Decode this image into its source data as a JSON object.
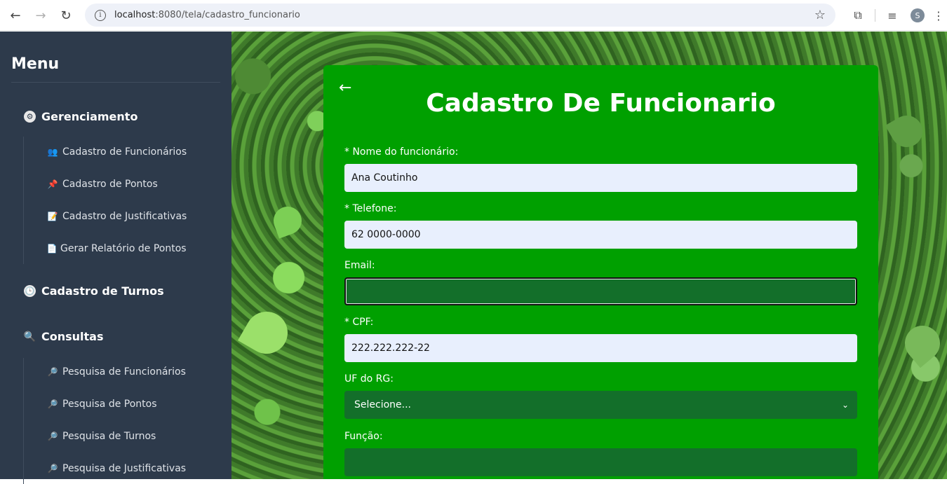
{
  "browser": {
    "url_host": "localhost",
    "url_path": ":8080/tela/cadastro_funcionario",
    "profile_initial": "S"
  },
  "sidebar": {
    "title": "Menu",
    "sections": [
      {
        "label": "Gerenciamento",
        "icon": "gear-icon",
        "items": [
          {
            "label": "Cadastro de Funcionários",
            "icon": "users-icon"
          },
          {
            "label": "Cadastro de Pontos",
            "icon": "pushpin-icon"
          },
          {
            "label": "Cadastro de Justificativas",
            "icon": "memo-icon"
          },
          {
            "label": "Gerar Relatório de Pontos",
            "icon": "document-icon"
          }
        ]
      },
      {
        "label": "Cadastro de Turnos",
        "icon": "clock-icon",
        "items": []
      },
      {
        "label": "Consultas",
        "icon": "search-icon",
        "items": [
          {
            "label": "Pesquisa de Funcionários",
            "icon": "magnifier-icon"
          },
          {
            "label": "Pesquisa de Pontos",
            "icon": "magnifier-icon"
          },
          {
            "label": "Pesquisa de Turnos",
            "icon": "magnifier-icon"
          },
          {
            "label": "Pesquisa de Justificativas",
            "icon": "magnifier-icon"
          }
        ]
      }
    ]
  },
  "form": {
    "back_label": "←",
    "title": "Cadastro De Funcionario",
    "fields": {
      "nome": {
        "label": "* Nome do funcionário:",
        "value": "Ana Coutinho"
      },
      "telefone": {
        "label": "* Telefone:",
        "value": "62 0000-0000"
      },
      "email": {
        "label": "Email:",
        "value": ""
      },
      "cpf": {
        "label": "* CPF:",
        "value": "222.222.222-22"
      },
      "uf_rg": {
        "label": "UF do RG:",
        "value": "Selecione..."
      },
      "funcao": {
        "label": "Função:",
        "value": ""
      }
    }
  },
  "colors": {
    "sidebar_bg": "#2d3a4b",
    "card_bg": "#00a000",
    "input_light": "#e8effd",
    "input_dark": "#136f2a"
  }
}
